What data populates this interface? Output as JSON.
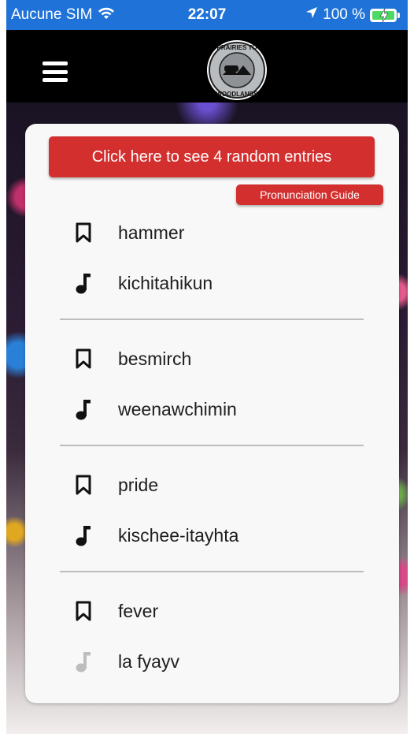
{
  "status_bar": {
    "carrier": "Aucune SIM",
    "time": "22:07",
    "battery": "100 %"
  },
  "header": {
    "logo_top_text": "PRAIRIES TO",
    "logo_bottom_text": "WOODLANDS"
  },
  "card": {
    "random_button_label": "Click here to see 4 random entries",
    "guide_button_label": "Pronunciation Guide",
    "entries": [
      {
        "english": "hammer",
        "translation": "kichitahikun",
        "audio_available": true
      },
      {
        "english": "besmirch",
        "translation": "weenawchimin",
        "audio_available": true
      },
      {
        "english": "pride",
        "translation": "kischee-itayhta",
        "audio_available": true
      },
      {
        "english": "fever",
        "translation": "la fyayv",
        "audio_available": false
      }
    ]
  },
  "colors": {
    "accent": "#d32f2f",
    "status_bar": "#1f73d8",
    "icon_active": "#111111",
    "icon_disabled": "#bdbdbd"
  }
}
